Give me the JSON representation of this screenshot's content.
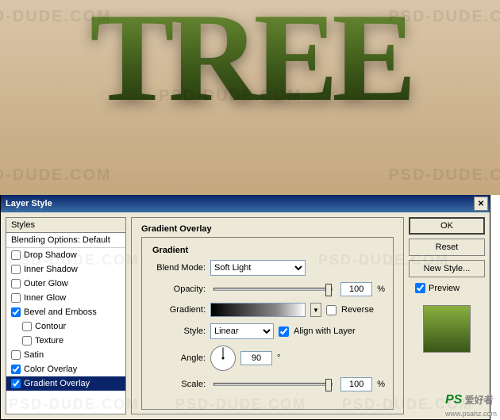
{
  "preview_text": "TREE",
  "watermark": "PSD-DUDE.COM",
  "dialog": {
    "title": "Layer Style",
    "close": "✕",
    "styles_header": "Styles",
    "blending_options": "Blending Options: Default",
    "items": [
      {
        "label": "Drop Shadow",
        "checked": false
      },
      {
        "label": "Inner Shadow",
        "checked": false
      },
      {
        "label": "Outer Glow",
        "checked": false
      },
      {
        "label": "Inner Glow",
        "checked": false
      },
      {
        "label": "Bevel and Emboss",
        "checked": true
      },
      {
        "label": "Contour",
        "checked": false,
        "indent": true
      },
      {
        "label": "Texture",
        "checked": false,
        "indent": true
      },
      {
        "label": "Satin",
        "checked": false
      },
      {
        "label": "Color Overlay",
        "checked": true
      },
      {
        "label": "Gradient Overlay",
        "checked": true,
        "selected": true
      }
    ],
    "panel": {
      "title": "Gradient Overlay",
      "fieldset": "Gradient",
      "blend_mode_label": "Blend Mode:",
      "blend_mode_value": "Soft Light",
      "opacity_label": "Opacity:",
      "opacity_value": "100",
      "opacity_unit": "%",
      "gradient_label": "Gradient:",
      "reverse_label": "Reverse",
      "style_label": "Style:",
      "style_value": "Linear",
      "align_label": "Align with Layer",
      "angle_label": "Angle:",
      "angle_value": "90",
      "angle_unit": "°",
      "scale_label": "Scale:",
      "scale_value": "100",
      "scale_unit": "%"
    },
    "buttons": {
      "ok": "OK",
      "reset": "Reset",
      "new_style": "New Style...",
      "preview": "Preview"
    }
  },
  "source": {
    "ps": "PS",
    "rest": " 爱好者",
    "url": "www.psahz.com"
  }
}
